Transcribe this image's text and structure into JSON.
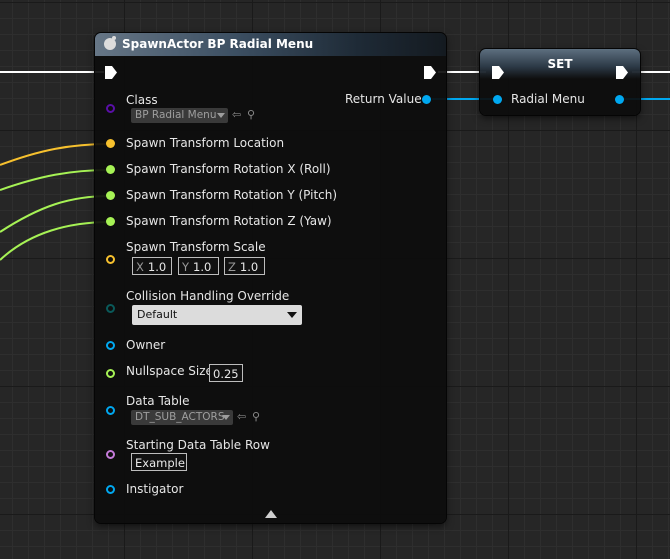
{
  "spawn_node": {
    "title": "SpawnActor BP Radial Menu",
    "output_return_label": "Return Value",
    "class_label": "Class",
    "class_value": "BP Radial Menu",
    "location_label": "Spawn Transform Location",
    "rot_x_label": "Spawn Transform Rotation X (Roll)",
    "rot_y_label": "Spawn Transform Rotation Y (Pitch)",
    "rot_z_label": "Spawn Transform Rotation Z (Yaw)",
    "scale_label": "Spawn Transform Scale",
    "scale": {
      "x_label": "X",
      "x": "1.0",
      "y_label": "Y",
      "y": "1.0",
      "z_label": "Z",
      "z": "1.0"
    },
    "collision_label": "Collision Handling Override",
    "collision_value": "Default",
    "owner_label": "Owner",
    "nullspace_label": "Nullspace Size",
    "nullspace_value": "0.25",
    "datatable_label": "Data Table",
    "datatable_value": "DT_SUB_ACTORS",
    "row_label": "Starting Data Table Row",
    "row_value": "Example",
    "instigator_label": "Instigator"
  },
  "set_node": {
    "title": "SET",
    "var_label": "Radial Menu"
  },
  "colors": {
    "exec": "#ffffff",
    "object": "#00a8f0",
    "class": "#5a0fa8",
    "vector": "#f7c12e",
    "float": "#a6f255",
    "enum": "#0a5a5a",
    "name": "#c57bd9"
  }
}
